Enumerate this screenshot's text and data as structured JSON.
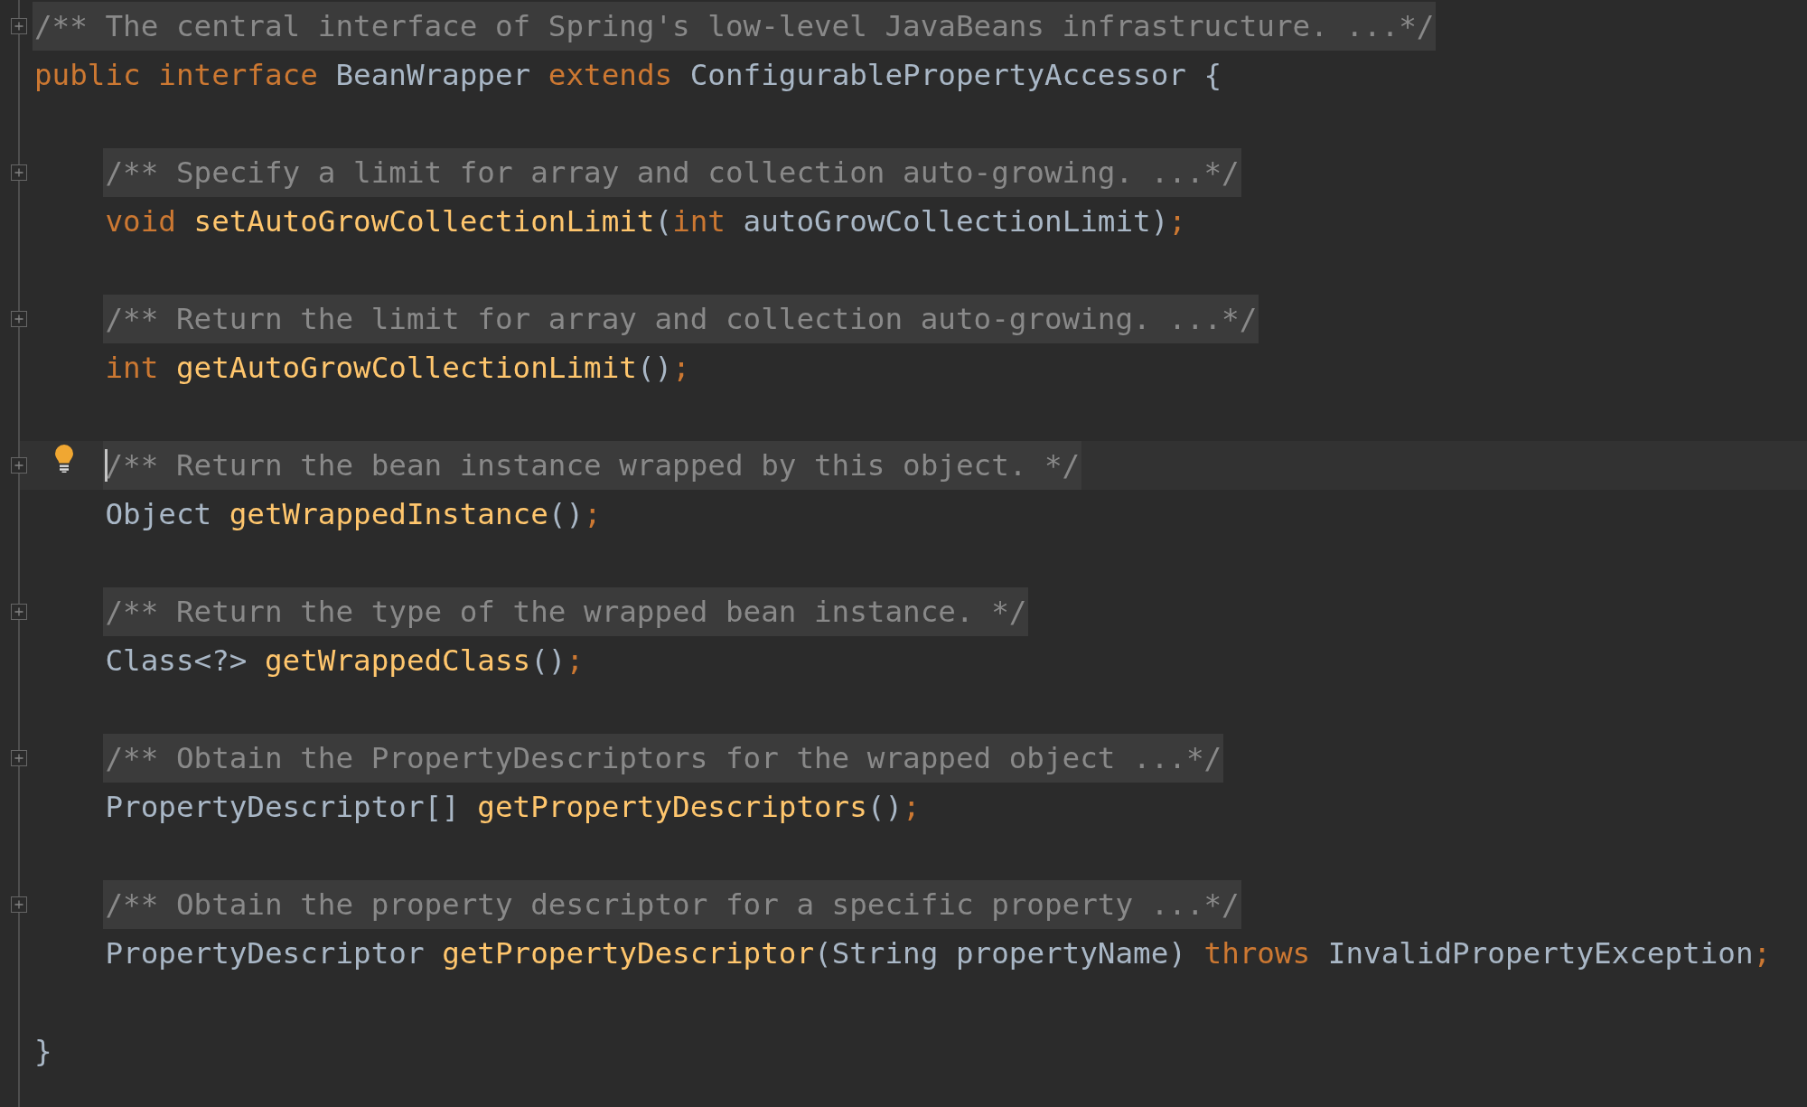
{
  "editor": {
    "lines": [
      {
        "kind": "folded_comment",
        "text": "/** The central interface of Spring's low-level JavaBeans infrastructure. ...*/",
        "current": false
      },
      {
        "kind": "code",
        "current": false,
        "tokens": [
          {
            "kind": "keyword",
            "text": "public "
          },
          {
            "kind": "keyword",
            "text": "interface "
          },
          {
            "kind": "plain",
            "text": "BeanWrapper "
          },
          {
            "kind": "keyword",
            "text": "extends "
          },
          {
            "kind": "plain",
            "text": "ConfigurablePropertyAccessor {"
          }
        ],
        "children": [
          {
            "kind": "blank",
            "current": false
          },
          {
            "kind": "folded_comment",
            "text": "/** Specify a limit for array and collection auto-growing. ...*/",
            "current": false
          },
          {
            "kind": "code",
            "current": false,
            "tokens": [
              {
                "kind": "keyword",
                "text": "void "
              },
              {
                "kind": "method",
                "text": "setAutoGrowCollectionLimit"
              },
              {
                "kind": "plain",
                "text": "("
              },
              {
                "kind": "keyword",
                "text": "int "
              },
              {
                "kind": "plain",
                "text": "autoGrowCollectionLimit)"
              },
              {
                "kind": "semicolon",
                "text": ";"
              }
            ]
          },
          {
            "kind": "blank",
            "current": false
          },
          {
            "kind": "folded_comment",
            "text": "/** Return the limit for array and collection auto-growing. ...*/",
            "current": false
          },
          {
            "kind": "code",
            "current": false,
            "tokens": [
              {
                "kind": "keyword",
                "text": "int "
              },
              {
                "kind": "method",
                "text": "getAutoGrowCollectionLimit"
              },
              {
                "kind": "plain",
                "text": "()"
              },
              {
                "kind": "semicolon",
                "text": ";"
              }
            ]
          },
          {
            "kind": "blank",
            "current": false
          },
          {
            "kind": "folded_comment",
            "text": "/** Return the bean instance wrapped by this object. */",
            "current": true
          },
          {
            "kind": "code",
            "current": false,
            "tokens": [
              {
                "kind": "plain",
                "text": "Object "
              },
              {
                "kind": "method",
                "text": "getWrappedInstance"
              },
              {
                "kind": "plain",
                "text": "()"
              },
              {
                "kind": "semicolon",
                "text": ";"
              }
            ]
          },
          {
            "kind": "blank",
            "current": false
          },
          {
            "kind": "folded_comment",
            "text": "/** Return the type of the wrapped bean instance. */",
            "current": false
          },
          {
            "kind": "code",
            "current": false,
            "tokens": [
              {
                "kind": "plain",
                "text": "Class<?> "
              },
              {
                "kind": "method",
                "text": "getWrappedClass"
              },
              {
                "kind": "plain",
                "text": "()"
              },
              {
                "kind": "semicolon",
                "text": ";"
              }
            ]
          },
          {
            "kind": "blank",
            "current": false
          },
          {
            "kind": "folded_comment",
            "text": "/** Obtain the PropertyDescriptors for the wrapped object ...*/",
            "current": false
          },
          {
            "kind": "code",
            "current": false,
            "tokens": [
              {
                "kind": "plain",
                "text": "PropertyDescriptor[] "
              },
              {
                "kind": "method",
                "text": "getPropertyDescriptors"
              },
              {
                "kind": "plain",
                "text": "()"
              },
              {
                "kind": "semicolon",
                "text": ";"
              }
            ]
          },
          {
            "kind": "blank",
            "current": false
          },
          {
            "kind": "folded_comment",
            "text": "/** Obtain the property descriptor for a specific property ...*/",
            "current": false
          },
          {
            "kind": "code",
            "current": false,
            "tokens": [
              {
                "kind": "plain",
                "text": "PropertyDescriptor "
              },
              {
                "kind": "method",
                "text": "getPropertyDescriptor"
              },
              {
                "kind": "plain",
                "text": "(String propertyName) "
              },
              {
                "kind": "keyword",
                "text": "throws "
              },
              {
                "kind": "plain",
                "text": "InvalidPropertyException"
              },
              {
                "kind": "semicolon",
                "text": ";"
              }
            ]
          },
          {
            "kind": "blank",
            "current": false
          }
        ]
      },
      {
        "kind": "code",
        "current": false,
        "tokens": [
          {
            "kind": "plain",
            "text": "}"
          }
        ]
      }
    ]
  }
}
